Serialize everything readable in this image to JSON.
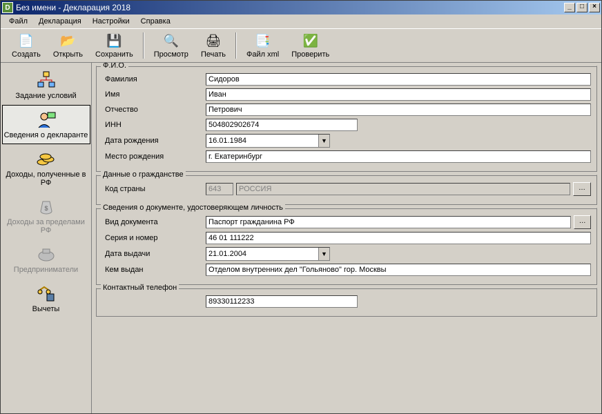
{
  "window": {
    "title": "Без имени - Декларация 2018"
  },
  "menu": {
    "file": "Файл",
    "declaration": "Декларация",
    "settings": "Настройки",
    "help": "Справка"
  },
  "toolbar": {
    "create": "Создать",
    "open": "Открыть",
    "save": "Сохранить",
    "preview": "Просмотр",
    "print": "Печать",
    "filexml": "Файл xml",
    "check": "Проверить"
  },
  "sidebar": {
    "conditions": "Задание условий",
    "declarant": "Сведения о декларанте",
    "income_rf": "Доходы, полученные в РФ",
    "income_foreign": "Доходы за пределами РФ",
    "entrepreneurs": "Предприниматели",
    "deductions": "Вычеты"
  },
  "groups": {
    "fio": "Ф.И.О.",
    "citizenship": "Данные о гражданстве",
    "identity": "Сведения о документе, удостоверяющем личность",
    "phone": "Контактный телефон"
  },
  "labels": {
    "surname": "Фамилия",
    "name": "Имя",
    "patronymic": "Отчество",
    "inn": "ИНН",
    "dob": "Дата рождения",
    "pob": "Место рождения",
    "country_code": "Код страны",
    "doc_type": "Вид документа",
    "series_number": "Серия и номер",
    "issue_date": "Дата выдачи",
    "issued_by": "Кем выдан"
  },
  "values": {
    "surname": "Сидоров",
    "name": "Иван",
    "patronymic": "Петрович",
    "inn": "504802902674",
    "dob": "16.01.1984",
    "pob": "г. Екатеринбург",
    "country_code": "643",
    "country_name": "РОССИЯ",
    "doc_type": "Паспорт гражданина РФ",
    "series_number": "46 01 111222",
    "issue_date": "21.01.2004",
    "issued_by": "Отделом внутренних дел \"Гольяново\" гор. Москвы",
    "phone": "89330112233"
  }
}
